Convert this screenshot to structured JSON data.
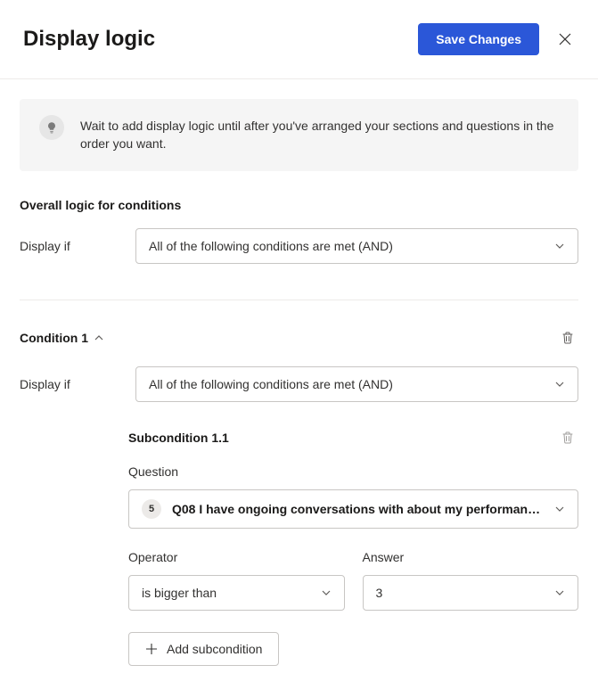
{
  "header": {
    "title": "Display logic",
    "save_label": "Save Changes"
  },
  "info": {
    "text": "Wait to add display logic until after you've arranged your sections and questions in the order you want."
  },
  "overall": {
    "section_title": "Overall logic for conditions",
    "display_if_label": "Display if",
    "display_if_value": "All of the following conditions are met (AND)"
  },
  "condition": {
    "title": "Condition 1",
    "display_if_label": "Display if",
    "display_if_value": "All of the following conditions are met (AND)",
    "subcondition": {
      "title": "Subcondition 1.1",
      "question_label": "Question",
      "question_badge": "5",
      "question_text": "Q08 I have ongoing conversations with about my performan…",
      "operator_label": "Operator",
      "operator_value": "is bigger than",
      "answer_label": "Answer",
      "answer_value": "3"
    },
    "add_subcondition_label": "Add subcondition"
  }
}
